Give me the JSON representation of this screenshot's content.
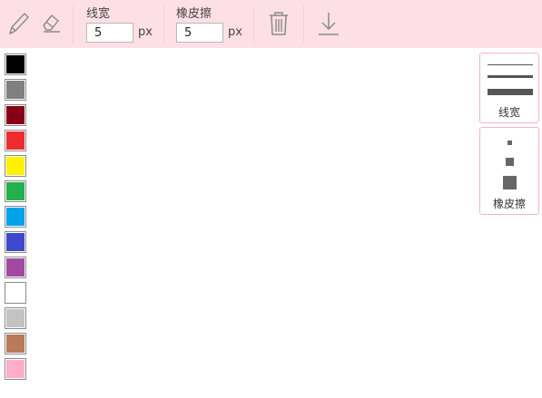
{
  "toolbar": {
    "pencil_icon": "pencil-icon",
    "eraser_icon": "eraser-icon",
    "line_width": {
      "label": "线宽",
      "value": "5",
      "unit": "px"
    },
    "eraser_size": {
      "label": "橡皮擦",
      "value": "5",
      "unit": "px"
    },
    "clear_icon": "trash-icon",
    "download_icon": "download-icon"
  },
  "palette": {
    "colors": [
      "#000000",
      "#808080",
      "#880015",
      "#ed2d2d",
      "#fff200",
      "#22b14c",
      "#00a2e8",
      "#3f48cc",
      "#a349a4",
      "#ffffff",
      "#c3c3c3",
      "#b97a57",
      "#ffaec9"
    ]
  },
  "side_panels": {
    "line_width_label": "线宽",
    "eraser_label": "橡皮擦"
  },
  "colors": {
    "toolbar_bg": "#fde0e5",
    "panel_border": "#f2b6c1"
  }
}
